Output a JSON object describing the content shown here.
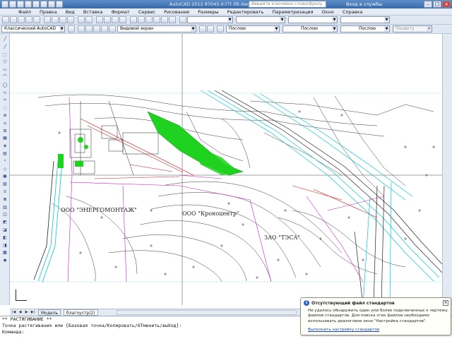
{
  "titlebar": {
    "title": "AutoCAD 2012    87045-II-ГП Лб.dwg",
    "search_placeholder": "Введите ключевое слово/фразу",
    "login": "Вход в службы"
  },
  "menu": [
    "Файл",
    "Правка",
    "Вид",
    "Вставка",
    "Формат",
    "Сервис",
    "Рисование",
    "Размеры",
    "Редактировать",
    "Параметризация",
    "Окно",
    "Справка"
  ],
  "toolbar": {
    "workspace": "Классический AutoCAD",
    "view_combo": "Видовой экран",
    "layer_combo1": "Послою",
    "layer_combo2": "Послою",
    "layer_combo3": "Послою",
    "plotstyle": "Поцвету"
  },
  "drawing": {
    "label_energo": "ООО \"ЭНЕРГОМОНТАЖ\"",
    "label_kronos": "ООО \"Кроноцентр\"",
    "label_tesa": "ЗАО \"ТЭСА\""
  },
  "tabs": {
    "model": "Модель",
    "layout": "благоустр(2)"
  },
  "command": {
    "line1": "** РАСТЯГИВАНИЕ **",
    "line2": "Точка растягивания или [Базовая точка/Копировать/ОТменить/выХод]:",
    "line3": "Команда:"
  },
  "popup": {
    "title": "Отсутствующий файл стандартов",
    "body": "Не удалось обнаружить один или более подключенных к чертежу файлов стандартов. Для поиска этих файлов необходимо использовать диалоговое окно \"Настройка стандартов\".",
    "link": "Выполнить настройку стандартов"
  },
  "colors": {
    "green_fill": "#1fd21f",
    "cyan_lines": "#00c8d2",
    "magenta_lines": "#d01ed0",
    "red_lines": "#c81e1e"
  }
}
